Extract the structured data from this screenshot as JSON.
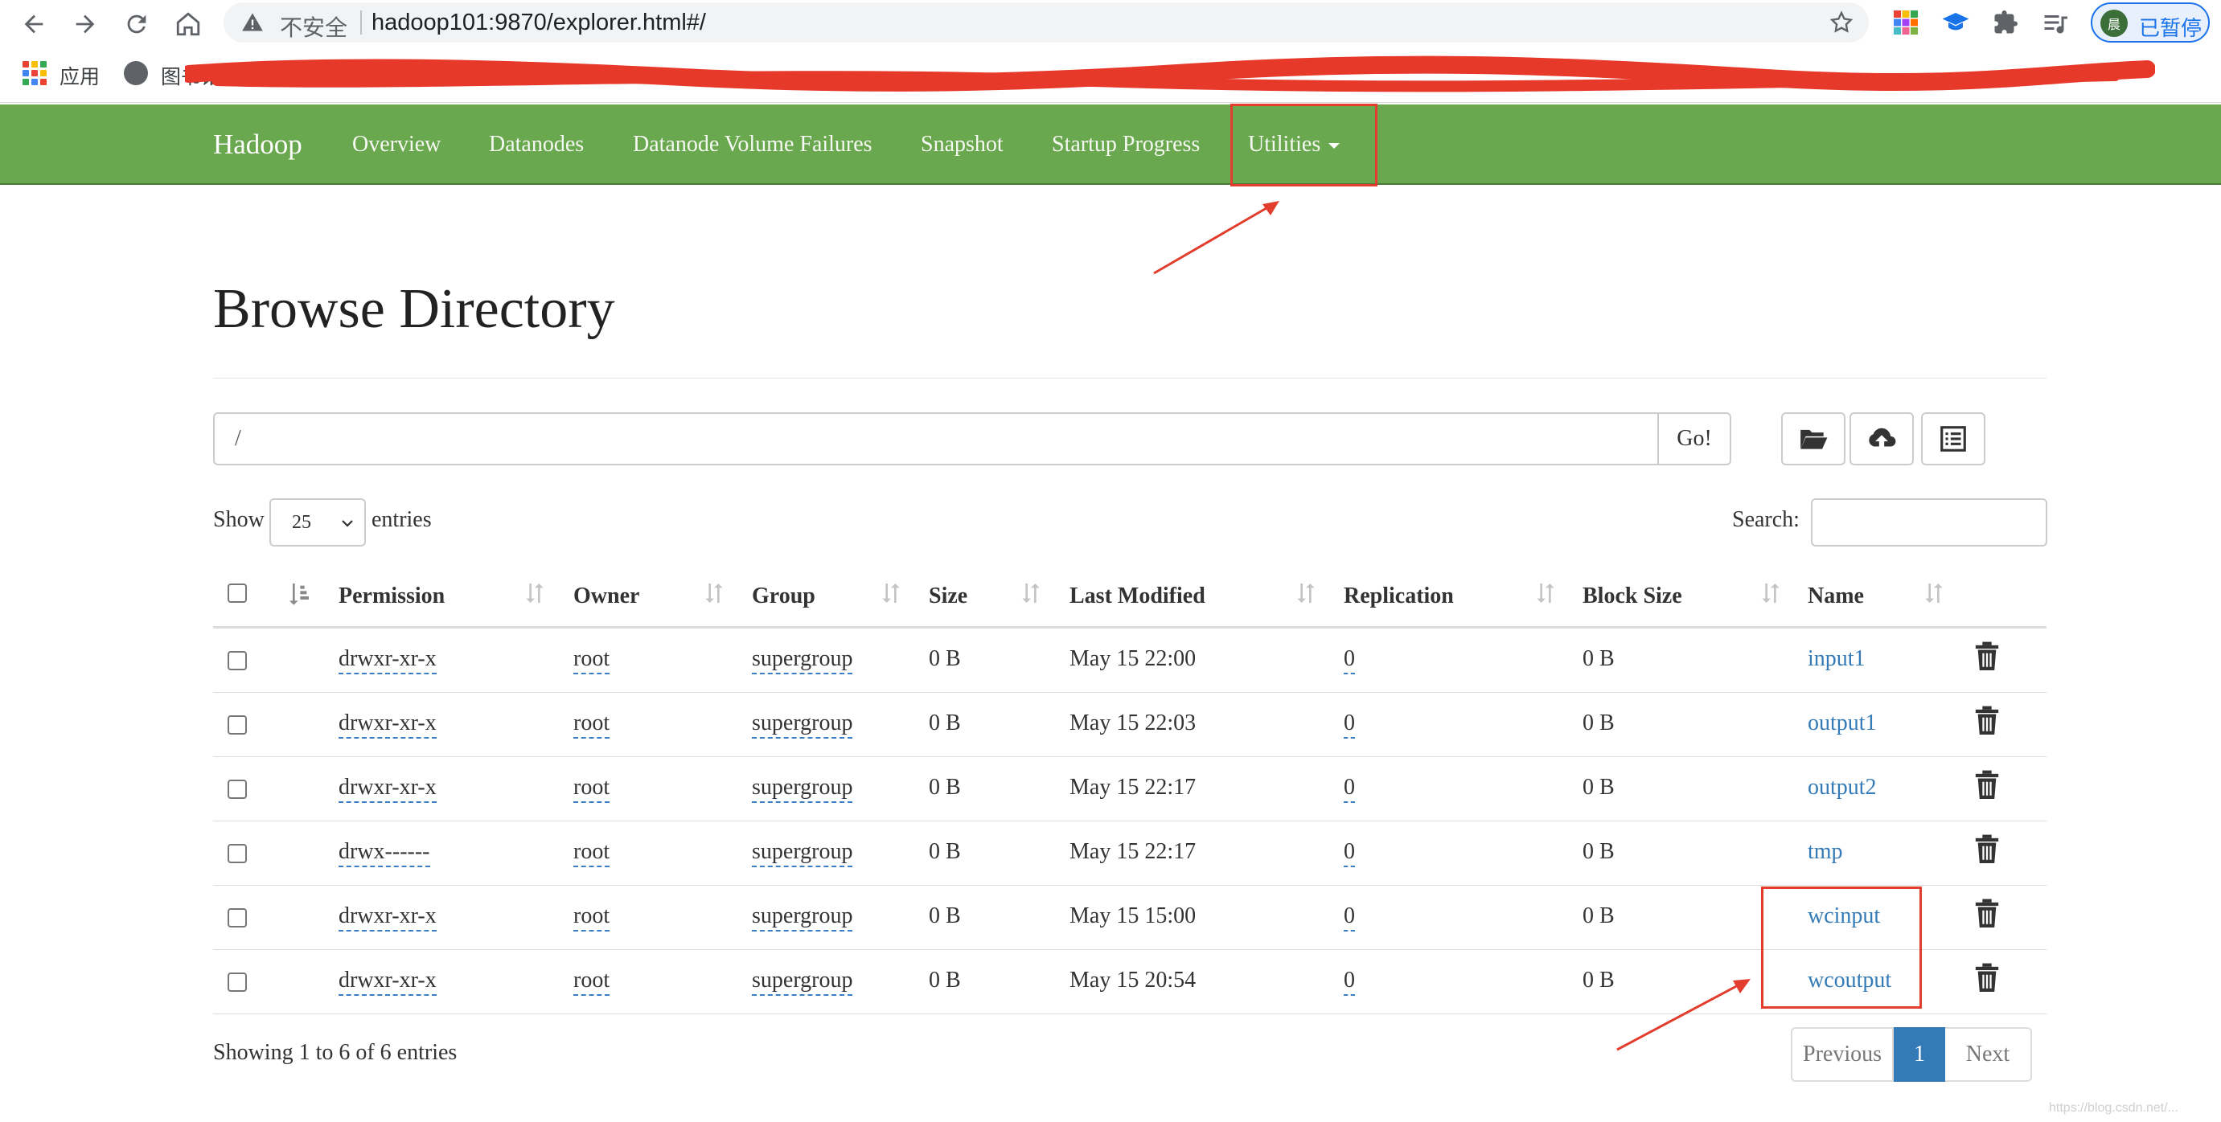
{
  "browser": {
    "security_label": "不安全",
    "url": "hadoop101:9870/explorer.html#/",
    "profile_status": "已暂停",
    "profile_initial": "晨",
    "bookmarks": {
      "apps_label": "应用",
      "library_label": "图书馆"
    }
  },
  "navbar": {
    "brand": "Hadoop",
    "items": [
      {
        "label": "Overview"
      },
      {
        "label": "Datanodes"
      },
      {
        "label": "Datanode Volume Failures"
      },
      {
        "label": "Snapshot"
      },
      {
        "label": "Startup Progress"
      },
      {
        "label": "Utilities"
      }
    ]
  },
  "page": {
    "title": "Browse Directory",
    "path_value": "/",
    "go_label": "Go!",
    "tools": [
      {
        "icon": "folder-open-icon"
      },
      {
        "icon": "cloud-upload-icon"
      },
      {
        "icon": "list-alt-icon"
      }
    ]
  },
  "length_menu": {
    "show_label": "Show",
    "value": "25",
    "entries_label": "entries"
  },
  "search": {
    "label": "Search:",
    "value": ""
  },
  "table": {
    "columns": [
      "Permission",
      "Owner",
      "Group",
      "Size",
      "Last Modified",
      "Replication",
      "Block Size",
      "Name"
    ],
    "rows": [
      {
        "permission": "drwxr-xr-x",
        "owner": "root",
        "group": "supergroup",
        "size": "0 B",
        "modified": "May 15 22:00",
        "replication": "0",
        "block_size": "0 B",
        "name": "input1"
      },
      {
        "permission": "drwxr-xr-x",
        "owner": "root",
        "group": "supergroup",
        "size": "0 B",
        "modified": "May 15 22:03",
        "replication": "0",
        "block_size": "0 B",
        "name": "output1"
      },
      {
        "permission": "drwxr-xr-x",
        "owner": "root",
        "group": "supergroup",
        "size": "0 B",
        "modified": "May 15 22:17",
        "replication": "0",
        "block_size": "0 B",
        "name": "output2"
      },
      {
        "permission": "drwx------",
        "owner": "root",
        "group": "supergroup",
        "size": "0 B",
        "modified": "May 15 22:17",
        "replication": "0",
        "block_size": "0 B",
        "name": "tmp"
      },
      {
        "permission": "drwxr-xr-x",
        "owner": "root",
        "group": "supergroup",
        "size": "0 B",
        "modified": "May 15 15:00",
        "replication": "0",
        "block_size": "0 B",
        "name": "wcinput"
      },
      {
        "permission": "drwxr-xr-x",
        "owner": "root",
        "group": "supergroup",
        "size": "0 B",
        "modified": "May 15 20:54",
        "replication": "0",
        "block_size": "0 B",
        "name": "wcoutput"
      }
    ]
  },
  "footer": {
    "info": "Showing 1 to 6 of 6 entries",
    "prev_label": "Previous",
    "current_page": "1",
    "next_label": "Next"
  },
  "colors": {
    "navbar": "#6aa84f",
    "link": "#337ab7",
    "annotation": "#e23d2d"
  }
}
